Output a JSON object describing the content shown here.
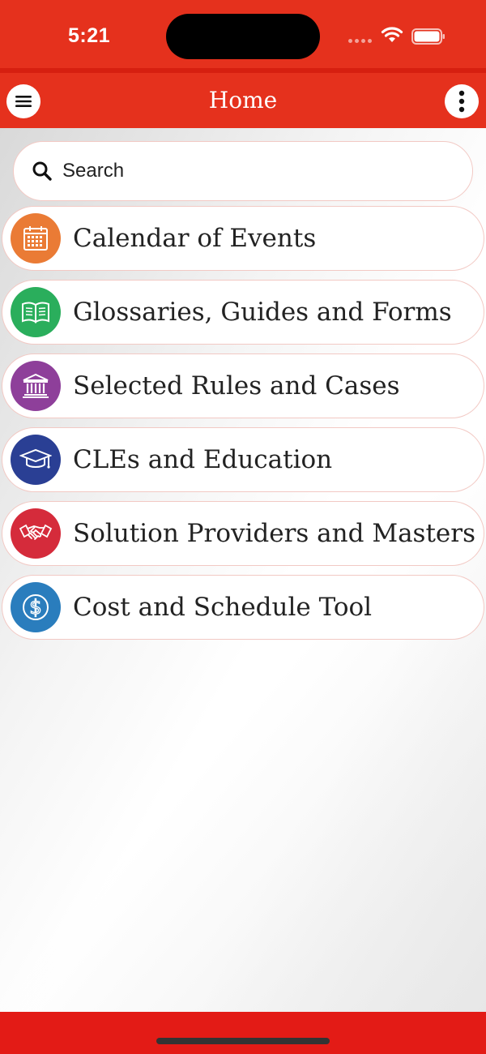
{
  "status_bar": {
    "time": "5:21"
  },
  "nav": {
    "title": "Home",
    "menu_icon": "hamburger-icon",
    "more_icon": "vertical-ellipsis-icon"
  },
  "search": {
    "placeholder": "Search",
    "icon": "search-icon"
  },
  "menu_items": [
    {
      "label": "Calendar of Events",
      "icon": "calendar-icon",
      "color": "#ea7b35"
    },
    {
      "label": "Glossaries, Guides and Forms",
      "icon": "book-icon",
      "color": "#2aae5c"
    },
    {
      "label": "Selected Rules and Cases",
      "icon": "courthouse-icon",
      "color": "#8e3f9a"
    },
    {
      "label": "CLEs and Education",
      "icon": "graduation-cap-icon",
      "color": "#2a3f94"
    },
    {
      "label": "Solution Providers and Masters",
      "icon": "handshake-icon",
      "color": "#d52b3b"
    },
    {
      "label": "Cost and Schedule Tool",
      "icon": "dollar-icon",
      "color": "#2a7dbd"
    }
  ],
  "colors": {
    "header": "#e5311d",
    "bottom_bar": "#e31b16",
    "item_border": "#f2c9c4"
  }
}
